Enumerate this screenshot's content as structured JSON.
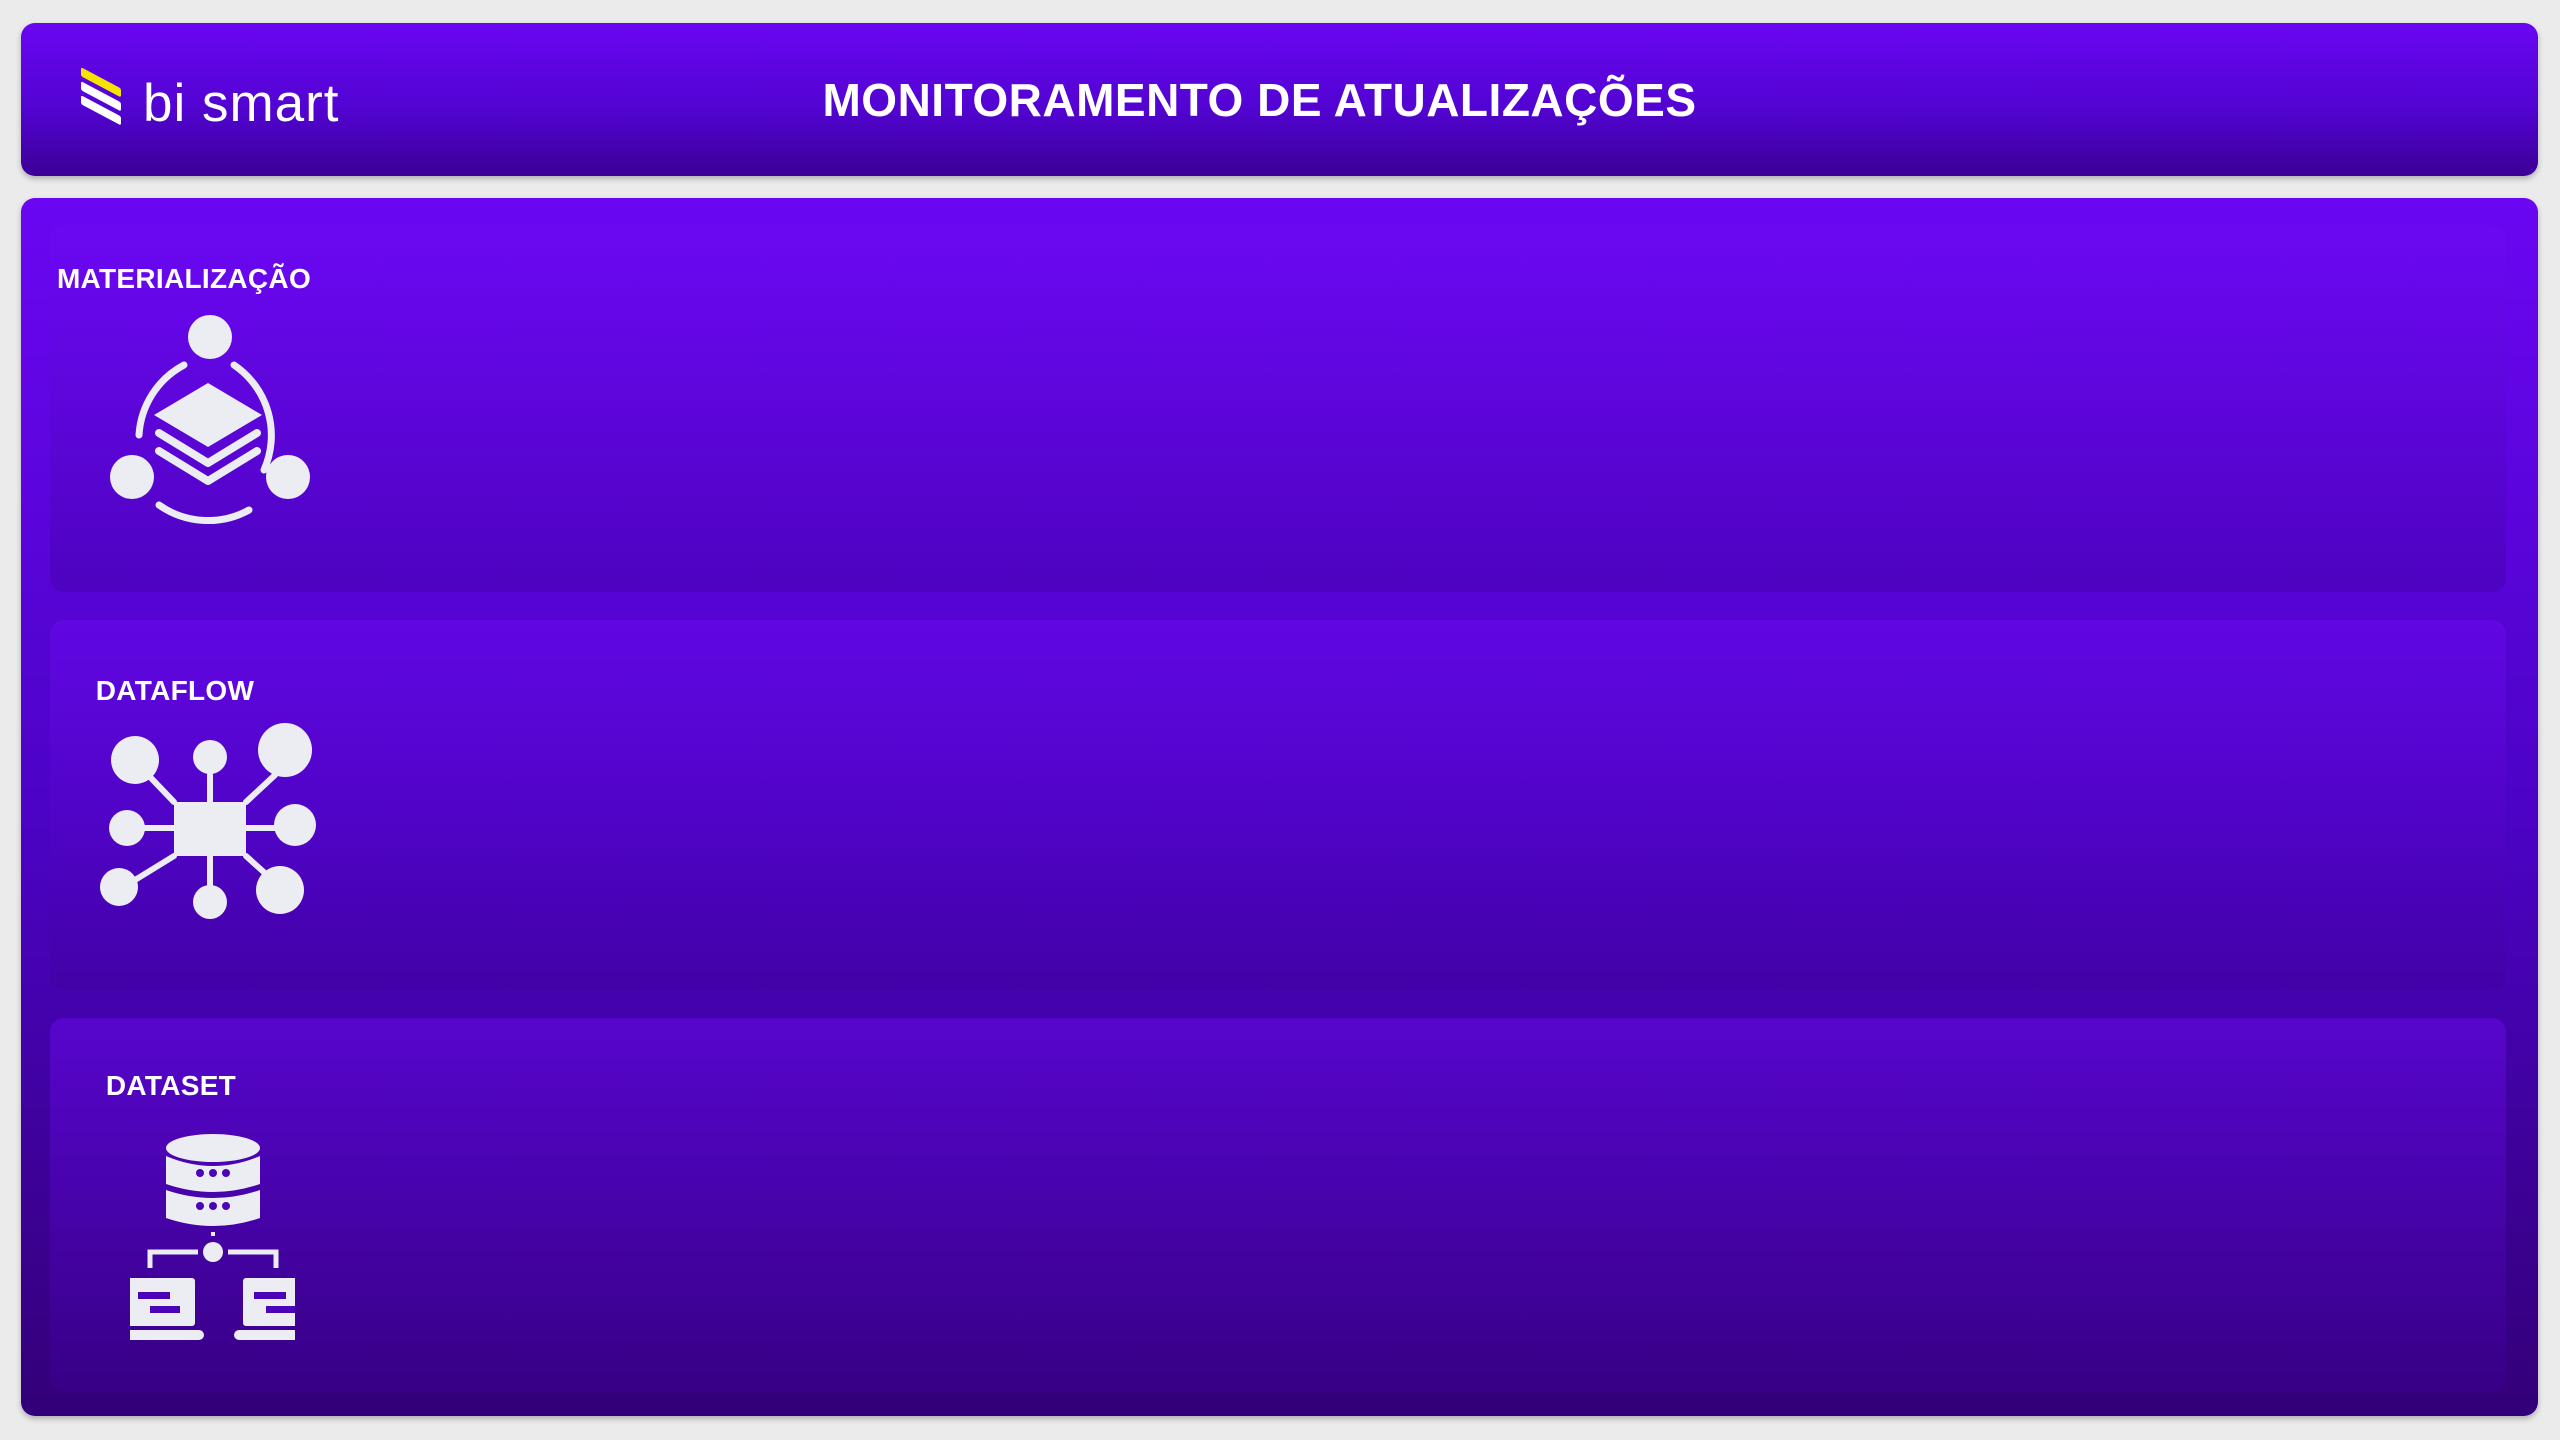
{
  "header": {
    "logo_text": "bi smart",
    "title": "MONITORAMENTO DE ATUALIZAÇÕES"
  },
  "sections": [
    {
      "label": "MATERIALIZAÇÃO",
      "icon": "layers-cycle-icon"
    },
    {
      "label": "DATAFLOW",
      "icon": "network-hub-icon"
    },
    {
      "label": "DATASET",
      "icon": "database-network-icon"
    }
  ],
  "colors": {
    "background": "#ebebeb",
    "panel_top": "#6a06f2",
    "panel_bottom": "#330078",
    "logo_accent": "#f5e400",
    "icon": "#ececf3"
  }
}
